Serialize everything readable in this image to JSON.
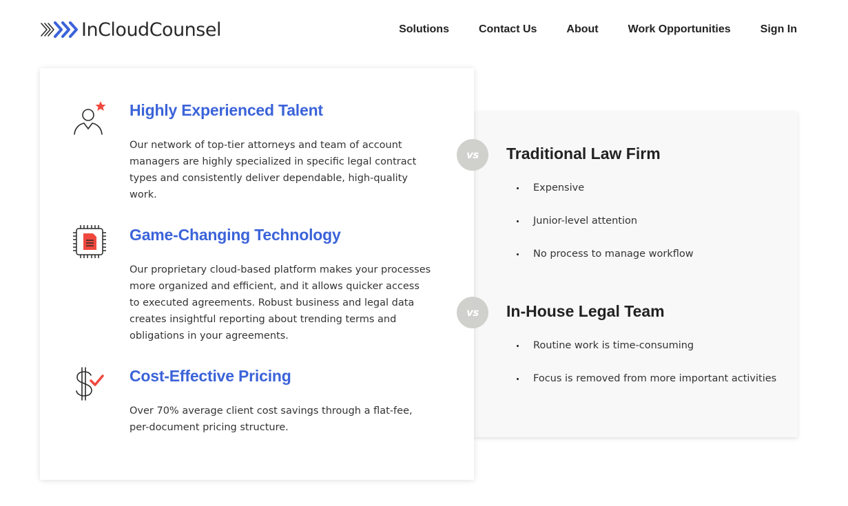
{
  "header": {
    "brand": "InCloudCounsel",
    "nav": [
      {
        "label": "Solutions"
      },
      {
        "label": "Contact Us"
      },
      {
        "label": "About"
      },
      {
        "label": "Work Opportunities"
      },
      {
        "label": "Sign In"
      }
    ]
  },
  "features": [
    {
      "icon": "person-star-icon",
      "title": "Highly Experienced Talent",
      "body": "Our network of top-tier attorneys and team of account managers are highly specialized in specific legal contract types and consistently deliver dependable, high-quality work."
    },
    {
      "icon": "chip-document-icon",
      "title": "Game-Changing Technology",
      "body": "Our proprietary cloud-based platform makes your processes more organized and efficient, and it allows quicker access to executed agreements. Robust business and legal data creates insightful reporting about trending terms and obligations in your agreements."
    },
    {
      "icon": "dollar-check-icon",
      "title": "Cost-Effective Pricing",
      "body": "Over 70% average client cost savings through a flat-fee, per-document pricing structure."
    }
  ],
  "comparisons": [
    {
      "badge": "vs",
      "title": "Traditional Law Firm",
      "points": [
        "Expensive",
        "Junior-level attention",
        "No process to manage workflow"
      ]
    },
    {
      "badge": "vs",
      "title": "In-House Legal Team",
      "points": [
        "Routine work is time-consuming",
        "Focus is removed from more important activities"
      ]
    }
  ],
  "colors": {
    "accent_blue": "#3b63d9",
    "accent_red": "#f0483e",
    "badge_gray": "#d0d0cc"
  }
}
